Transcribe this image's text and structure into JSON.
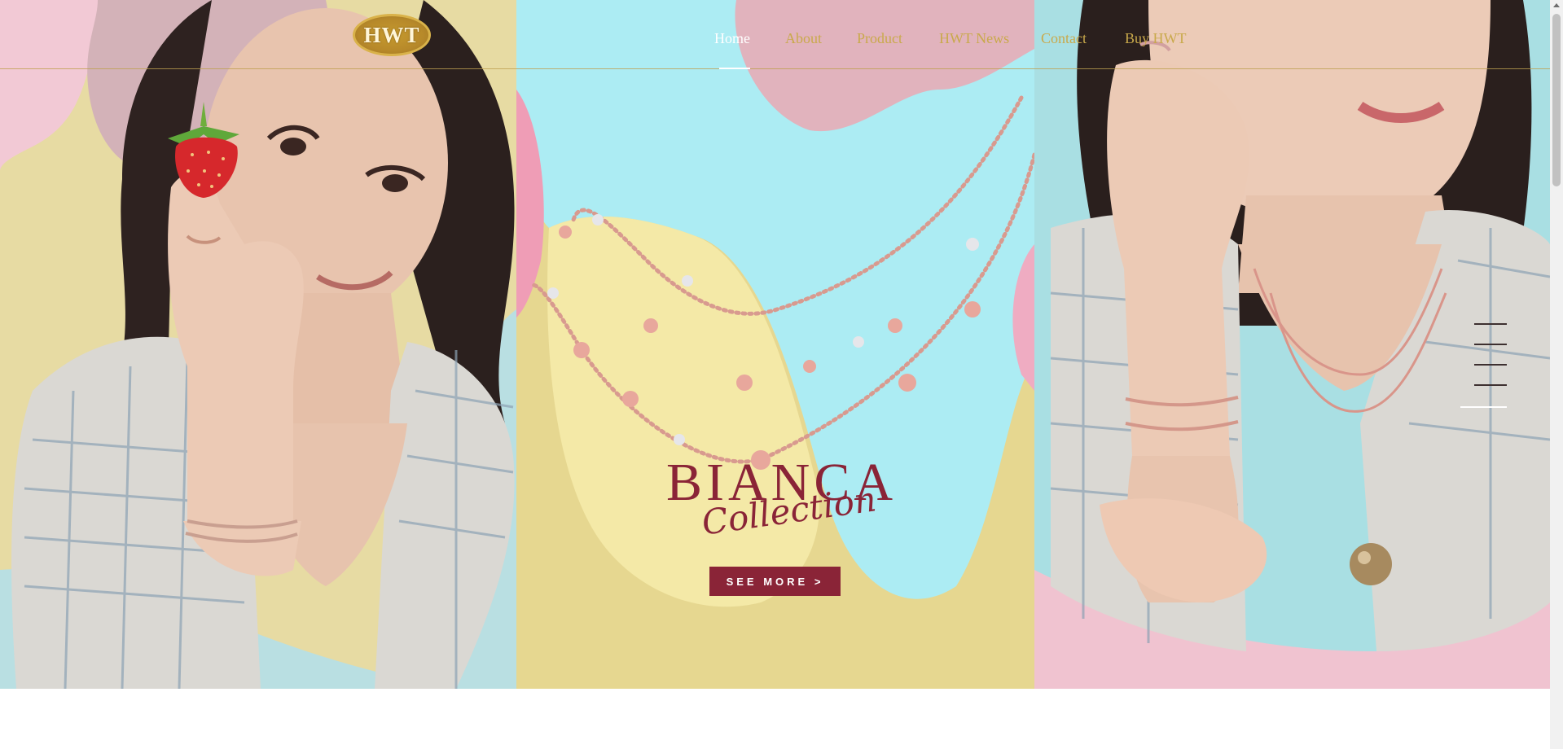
{
  "brand": {
    "logo_text": "HWT"
  },
  "nav": {
    "items": [
      {
        "label": "Home",
        "active": true
      },
      {
        "label": "About",
        "active": false
      },
      {
        "label": "Product",
        "active": false
      },
      {
        "label": "HWT News",
        "active": false
      },
      {
        "label": "Contact",
        "active": false
      },
      {
        "label": "Buy HWT",
        "active": false
      }
    ]
  },
  "hero": {
    "title": "BIANCA",
    "subtitle": "Collection",
    "cta_label": "SEE MORE >",
    "slide_count": 5,
    "active_slide": 5
  },
  "colors": {
    "accent": "#8a2437",
    "nav_gold": "#c9a94b",
    "cyan": "#a9e8f0",
    "pink": "#f0c2d0",
    "yellow": "#ecdfa0"
  },
  "icons": [
    "strawberry-icon",
    "scroll-up-arrow-icon"
  ]
}
